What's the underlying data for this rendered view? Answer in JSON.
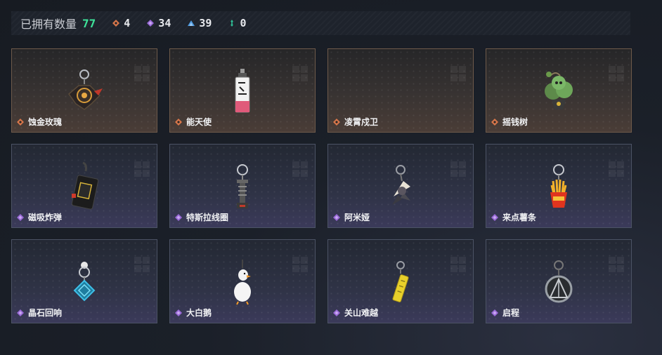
{
  "header": {
    "owned_label": "已拥有数量",
    "owned_count": "77",
    "stats": [
      {
        "icon": "orange-rarity-icon",
        "value": "4",
        "color": "#d9774a"
      },
      {
        "icon": "purple-rarity-icon",
        "value": "34",
        "color": "#9a6ad8"
      },
      {
        "icon": "blue-rarity-icon",
        "value": "39",
        "color": "#4f9adf"
      },
      {
        "icon": "green-rarity-icon",
        "value": "0",
        "color": "#2fc49a"
      }
    ]
  },
  "items": [
    {
      "name": "蚀金玫瑰",
      "rarity": "orange"
    },
    {
      "name": "能天使",
      "rarity": "orange"
    },
    {
      "name": "凌霄戍卫",
      "rarity": "orange"
    },
    {
      "name": "摇钱树",
      "rarity": "orange"
    },
    {
      "name": "磁吸炸弹",
      "rarity": "purple"
    },
    {
      "name": "特斯拉线圈",
      "rarity": "purple"
    },
    {
      "name": "阿米娅",
      "rarity": "purple"
    },
    {
      "name": "来点薯条",
      "rarity": "purple"
    },
    {
      "name": "晶石回响",
      "rarity": "purple"
    },
    {
      "name": "大白鹅",
      "rarity": "purple"
    },
    {
      "name": "关山难越",
      "rarity": "purple"
    },
    {
      "name": "启程",
      "rarity": "purple"
    }
  ],
  "colors": {
    "accent_green": "#3ee39a",
    "orange": "#d9774a",
    "purple": "#9a6ad8",
    "blue": "#4f9adf",
    "teal": "#2fc49a"
  }
}
